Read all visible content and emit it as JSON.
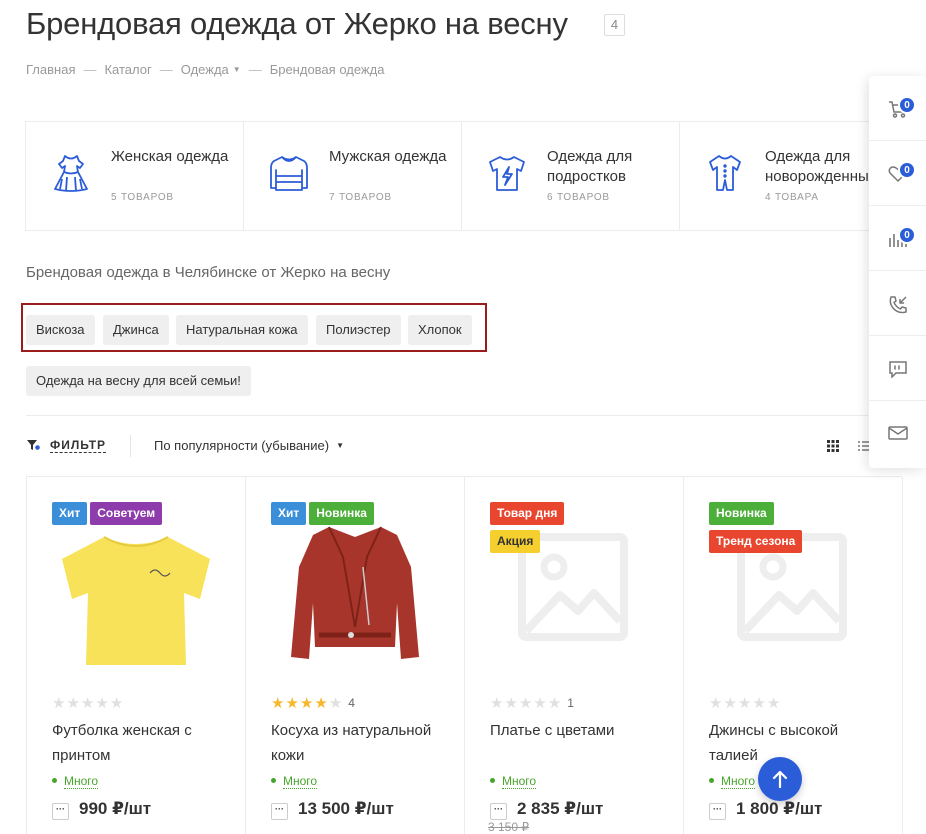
{
  "header": {
    "title": "Брендовая одежда от Жерко на весну",
    "count": "4"
  },
  "breadcrumb": [
    "Главная",
    "Каталог",
    "Одежда",
    "Брендовая одежда"
  ],
  "categories": [
    {
      "name": "Женская одежда",
      "count": "5 товаров",
      "icon": "dress-icon"
    },
    {
      "name": "Мужская одежда",
      "count": "7 товаров",
      "icon": "sweater-icon"
    },
    {
      "name": "Одежда для подростков",
      "count": "6 товаров",
      "icon": "tshirt-lightning-icon"
    },
    {
      "name": "Одежда для новорожденных",
      "count": "4 товара",
      "icon": "baby-romper-icon"
    }
  ],
  "seo_text": "Брендовая одежда в Челябинске от Жерко на весну",
  "tags": [
    "Вискоза",
    "Джинса",
    "Натуральная кожа",
    "Полиэстер",
    "Хлопок"
  ],
  "collection_tag": "Одежда на весну для всей семьи!",
  "toolbar": {
    "filter_label": "ФИЛЬТР",
    "sort_label": "По популярности (убывание)"
  },
  "colors": {
    "accent": "#2c5dd8",
    "badge_hit": "#3b8fd9",
    "badge_recommend": "#8e3bab",
    "badge_new": "#4caf3a",
    "badge_deal": "#e8462e",
    "badge_sale": "#f5cf2e",
    "in_stock": "#48a52c"
  },
  "products": [
    {
      "badges": [
        {
          "label": "Хит",
          "color": "#3b8fd9"
        },
        {
          "label": "Советуем",
          "color": "#8e3bab"
        }
      ],
      "image": "yellow-tshirt",
      "rating": 0,
      "reviews": "",
      "name": "Футболка женская с принтом",
      "stock": "Много",
      "price": "990 ₽/шт"
    },
    {
      "badges": [
        {
          "label": "Хит",
          "color": "#3b8fd9"
        },
        {
          "label": "Новинка",
          "color": "#4caf3a"
        }
      ],
      "image": "leather-jacket",
      "rating": 4,
      "reviews": "4",
      "name": "Косуха из натуральной кожи",
      "stock": "Много",
      "price": "13 500 ₽/шт"
    },
    {
      "badges": [
        {
          "label": "Товар дня",
          "color": "#e8462e"
        },
        {
          "label": "Акция",
          "color": "#f5cf2e"
        }
      ],
      "image": "image-placeholder",
      "rating": 0,
      "reviews": "1",
      "name": "Платье с цветами",
      "stock": "Много",
      "price": "2 835 ₽/шт",
      "old_price": "3 150 ₽"
    },
    {
      "badges": [
        {
          "label": "Новинка",
          "color": "#4caf3a"
        },
        {
          "label": "Тренд сезона",
          "color": "#e8462e"
        }
      ],
      "image": "image-placeholder",
      "rating": 0,
      "reviews": "",
      "name": "Джинсы с высокой талией",
      "stock": "Много",
      "price": "1 800 ₽/шт"
    }
  ],
  "side_panel": [
    {
      "icon": "cart-icon",
      "count": "0"
    },
    {
      "icon": "heart-icon",
      "count": "0"
    },
    {
      "icon": "compare-icon",
      "count": "0"
    },
    {
      "icon": "callback-icon"
    },
    {
      "icon": "chat-icon"
    },
    {
      "icon": "mail-icon"
    }
  ]
}
